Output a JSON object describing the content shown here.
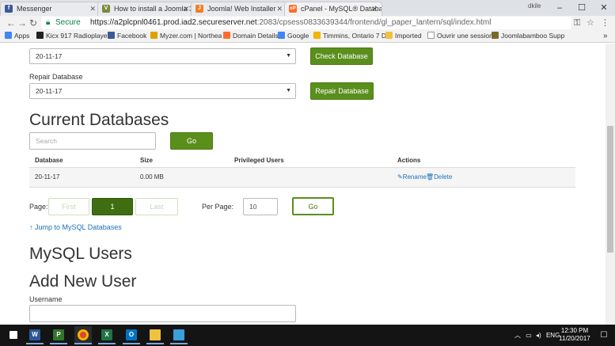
{
  "browser": {
    "tabs": [
      {
        "label": "Messenger",
        "favicon": "facebook-favicon",
        "color": "#3b5998",
        "glyph": "f"
      },
      {
        "label": "How to install a Joomla 3",
        "favicon": "doc-favicon",
        "color": "#7a8a3c",
        "glyph": "V"
      },
      {
        "label": "Joomla! Web Installer",
        "favicon": "joomla-favicon",
        "color": "#f47c20",
        "glyph": "J"
      },
      {
        "label": "cPanel - MySQL® Databa",
        "favicon": "cpanel-favicon",
        "color": "#ff6c2c",
        "glyph": "cP"
      }
    ],
    "user_label": "dkile",
    "address": {
      "secure_label": "Secure",
      "host": "https://a2plcpnl0461.prod.iad2.secureserver.net",
      "path": ":2083/cpsess0833639344/frontend/gl_paper_lantern/sql/index.html"
    },
    "bookmarks": [
      {
        "label": "Apps",
        "icon": "apps-icon",
        "color": "#4285f4"
      },
      {
        "label": "Kicx 917 Radioplayer",
        "icon": "kicx-icon",
        "color": "#222222"
      },
      {
        "label": "Facebook",
        "icon": "facebook-icon",
        "color": "#3b5998"
      },
      {
        "label": "Myzer.com | Northea",
        "icon": "myzer-icon",
        "color": "#e0a100"
      },
      {
        "label": "Domain Details",
        "icon": "cpanel-icon",
        "color": "#ff6c2c"
      },
      {
        "label": "Google",
        "icon": "google-icon",
        "color": "#4285f4"
      },
      {
        "label": "Timmins, Ontario 7 D",
        "icon": "weather-icon",
        "color": "#f4b400"
      },
      {
        "label": "Imported",
        "icon": "folder-icon",
        "color": "#f0c040"
      },
      {
        "label": "Ouvrir une session",
        "icon": "page-icon",
        "color": "#999999"
      },
      {
        "label": "Joomlabamboo Supp",
        "icon": "joomlabamboo-icon",
        "color": "#7a6a2a"
      }
    ]
  },
  "page": {
    "check_db": {
      "selected": "20-11-17",
      "button": "Check Database"
    },
    "repair_db": {
      "label": "Repair Database",
      "selected": "20-11-17",
      "button": "Repair Database"
    },
    "current_databases": {
      "title": "Current Databases",
      "search_placeholder": "Search",
      "go_button": "Go",
      "headers": {
        "database": "Database",
        "size": "Size",
        "users": "Privileged Users",
        "actions": "Actions"
      },
      "rows": [
        {
          "database": "20-11-17",
          "size": "0.00 MB",
          "users": "",
          "rename": "Rename",
          "delete": "Delete"
        }
      ]
    },
    "pagination": {
      "page_label": "Page:",
      "first": "First",
      "current": "1",
      "last": "Last",
      "per_page_label": "Per Page:",
      "per_page_value": "10",
      "go": "Go"
    },
    "jump_link": "Jump to MySQL Databases",
    "mysql_users_title": "MySQL Users",
    "add_user_title": "Add New User",
    "username_label": "Username"
  },
  "taskbar": {
    "apps": [
      "word",
      "project",
      "chrome",
      "excel",
      "outlook",
      "file-explorer",
      "remote-desktop"
    ],
    "language": "ENG",
    "time": "12:30 PM",
    "date": "11/20/2017"
  }
}
